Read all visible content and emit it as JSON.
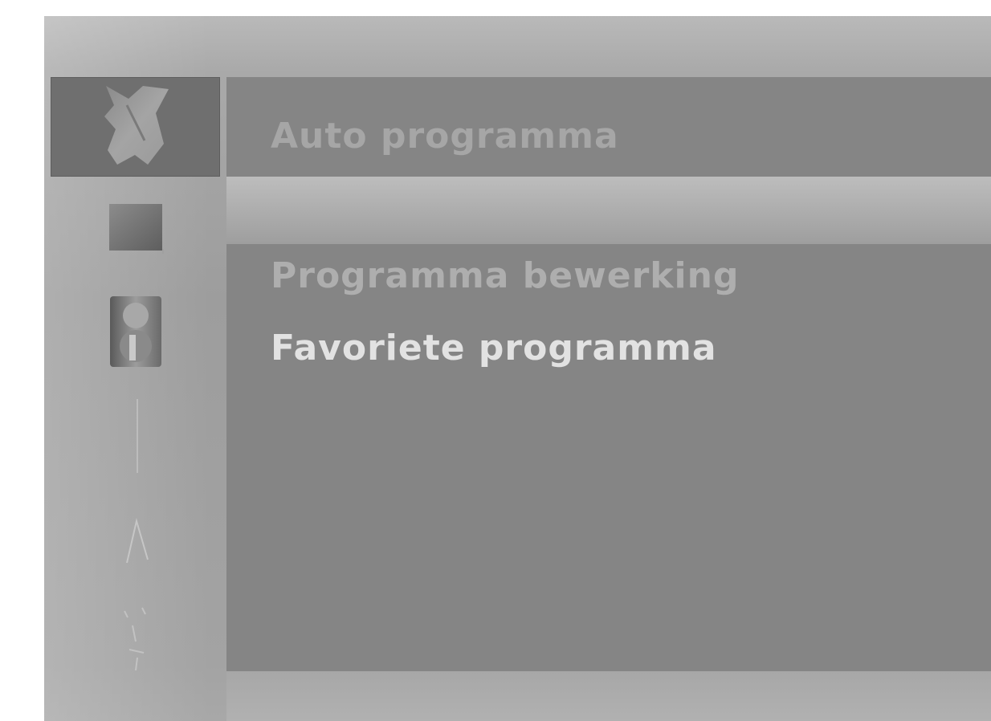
{
  "sidebar": {
    "icons": [
      {
        "name": "satellite-dish-icon",
        "selected": true
      },
      {
        "name": "picture-icon",
        "selected": false
      },
      {
        "name": "speaker-icon",
        "selected": false
      },
      {
        "name": "time-icon",
        "selected": false
      },
      {
        "name": "special-icon",
        "selected": false
      },
      {
        "name": "screen-icon",
        "selected": false
      }
    ]
  },
  "menu": {
    "items": [
      {
        "label": "Auto programma"
      },
      {
        "label": ""
      },
      {
        "label": "Programma bewerking"
      },
      {
        "label": "Favoriete programma"
      }
    ]
  },
  "colors": {
    "panel": "#858585",
    "selected_icon_bg": "#6f6f6f",
    "highlight": "#b3b3b3"
  }
}
